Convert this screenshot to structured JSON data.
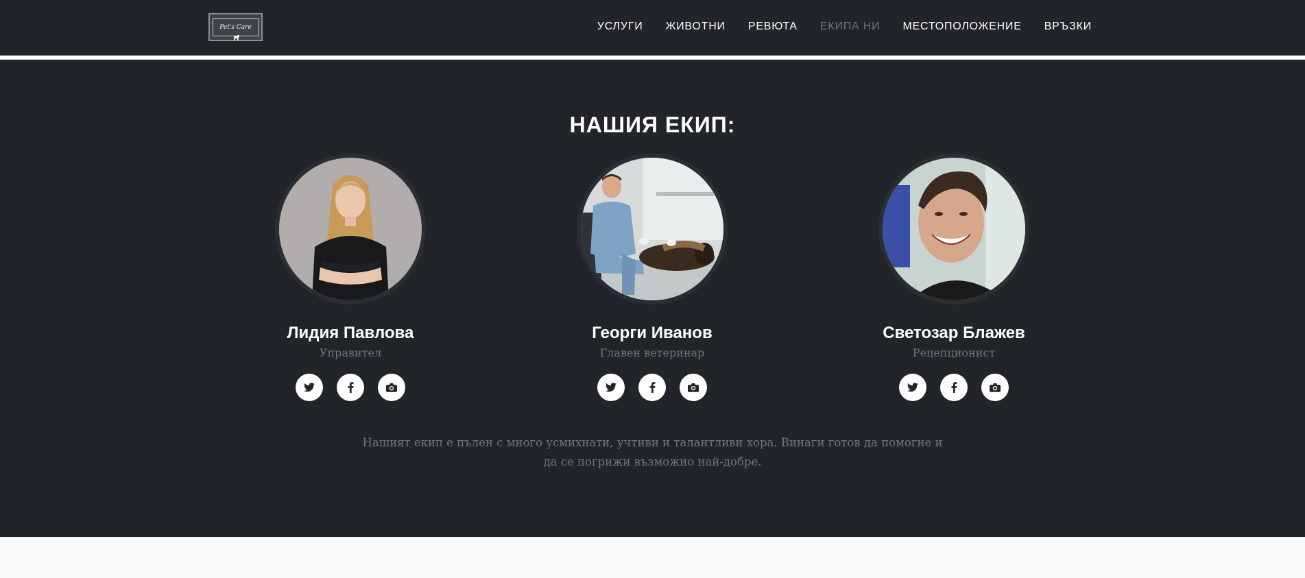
{
  "brand": {
    "logo_text": "Pet's Care"
  },
  "nav": {
    "items": [
      {
        "label": "УСЛУГИ",
        "active": false
      },
      {
        "label": "ЖИВОТНИ",
        "active": false
      },
      {
        "label": "РЕВЮТА",
        "active": false
      },
      {
        "label": "ЕКИПА НИ",
        "active": true
      },
      {
        "label": "МЕСТОПОЛОЖЕНИЕ",
        "active": false
      },
      {
        "label": "ВРЪЗКИ",
        "active": false
      }
    ]
  },
  "team": {
    "heading": "НАШИЯ ЕКИП:",
    "members": [
      {
        "name": "Лидия Павлова",
        "role": "Управител"
      },
      {
        "name": "Георги Иванов",
        "role": "Главен ветеринар"
      },
      {
        "name": "Светозар Блажев",
        "role": "Рецепционист"
      }
    ],
    "social_icons": [
      "twitter-icon",
      "facebook-icon",
      "camera-icon"
    ],
    "description": "Нашият екип е пълен с много усмихнати, учтиви и талантливи хора. Винаги готов да помогне и да се погрижи възможно най-добре."
  },
  "colors": {
    "dark_bg": "#212529",
    "muted_text": "#6c757d",
    "light_bg": "#f8f9fa"
  }
}
